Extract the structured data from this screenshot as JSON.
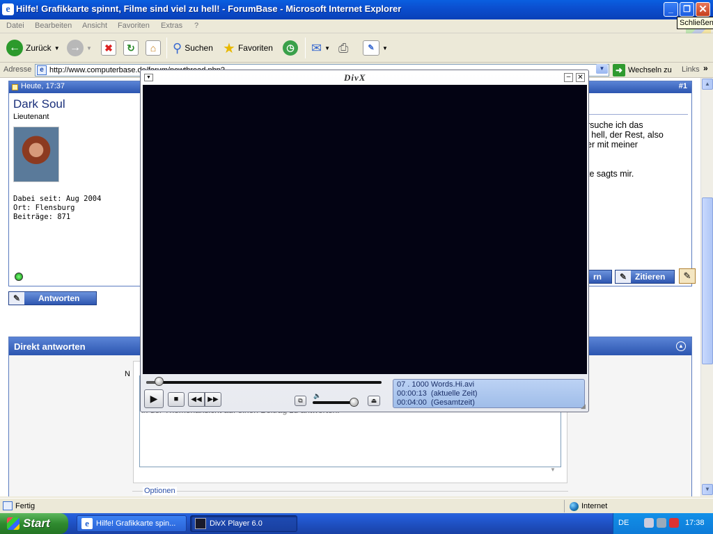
{
  "ie": {
    "title": "Hilfe! Grafikkarte spinnt, Filme sind viel zu hell! - ForumBase - Microsoft Internet Explorer",
    "tooltip": "Schließen",
    "menu": [
      "Datei",
      "Bearbeiten",
      "Ansicht",
      "Favoriten",
      "Extras",
      "?"
    ],
    "toolbar": {
      "back_label": "Zurück",
      "search_label": "Suchen",
      "favorites_label": "Favoriten"
    },
    "address": {
      "label": "Adresse",
      "url": "http://www.computerbase.de/forum/newthread.php?...",
      "go_label": "Wechseln zu",
      "links_label": "Links"
    },
    "status": {
      "text": "Fertig",
      "zone": "Internet"
    }
  },
  "forum": {
    "post": {
      "time": "Heute, 17:37",
      "number": "#1",
      "username": "Dark Soul",
      "rank": "Lieutenant",
      "stats": "Dabei seit: Aug 2004\nOrt: Flensburg\nBeiträge: 871",
      "text": "rsuche ich das\nl hell, der Rest, also\ner mit meiner\n\n\nte sagts mir.",
      "partial_button": "rn",
      "quote_button": "Zitieren"
    },
    "reply_button": "Antworten",
    "direct": {
      "title": "Direkt antworten",
      "name_label": "N",
      "hint": "Bitte Klicke auf einen der \"Direkt antworten\"-Symbole unten rechts in den Beiträgen, um unkompliziert direkt in der Themenansicht auf einen Beitrag zu antworten.",
      "options_label": "Optionen"
    }
  },
  "divx": {
    "logo": "DivX",
    "seek_position": 0.054,
    "volume_level": 0.9,
    "info": {
      "line1": "07 . 1000 Words.Hi.avi",
      "line2": "00:00:13  (aktuelle Zeit)",
      "line3": "00:04:00  (Gesamtzeit)"
    }
  },
  "taskbar": {
    "start_label": "Start",
    "tasks": [
      {
        "label": "Hilfe! Grafikkarte spin..."
      },
      {
        "label": "DivX Player 6.0"
      }
    ],
    "language": "DE",
    "clock": "17:38"
  }
}
